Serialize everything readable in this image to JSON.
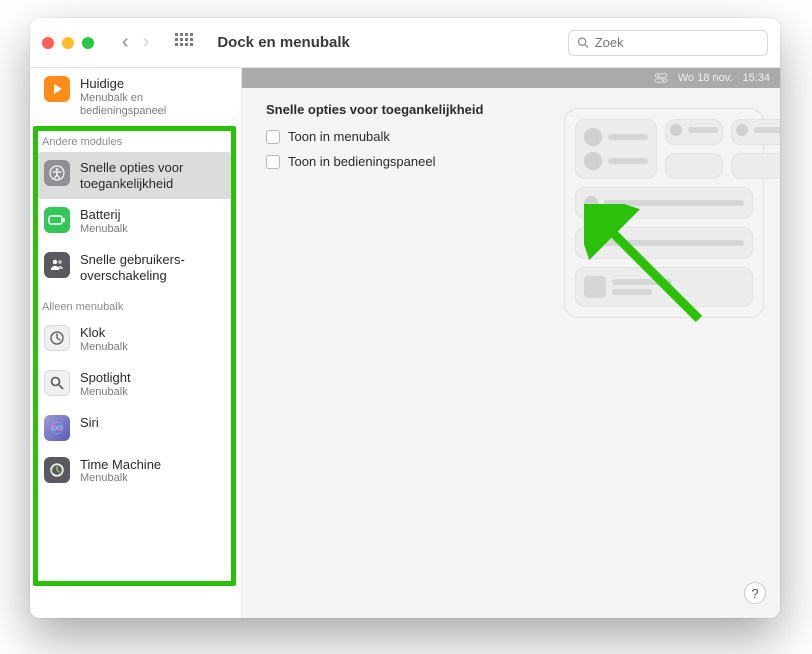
{
  "window": {
    "title": "Dock en menubalk",
    "search_placeholder": "Zoek"
  },
  "menubar_preview": {
    "date": "Wo 18 nov.",
    "time": "15:34"
  },
  "sidebar": {
    "top_item": {
      "label": "Huidige",
      "sub": "Menubalk en bedieningspaneel"
    },
    "section1_header": "Andere modules",
    "section1": [
      {
        "label": "Snelle opties voor toegankelijkheid",
        "sub": ""
      },
      {
        "label": "Batterij",
        "sub": "Menubalk"
      },
      {
        "label": "Snelle gebruikers-overschakeling",
        "sub": ""
      }
    ],
    "section2_header": "Alleen menubalk",
    "section2": [
      {
        "label": "Klok",
        "sub": "Menubalk"
      },
      {
        "label": "Spotlight",
        "sub": "Menubalk"
      },
      {
        "label": "Siri",
        "sub": ""
      },
      {
        "label": "Time Machine",
        "sub": "Menubalk"
      }
    ]
  },
  "main": {
    "heading": "Snelle opties voor toegankelijkheid",
    "option1": "Toon in menubalk",
    "option2": "Toon in bedieningspaneel"
  },
  "help_label": "?"
}
